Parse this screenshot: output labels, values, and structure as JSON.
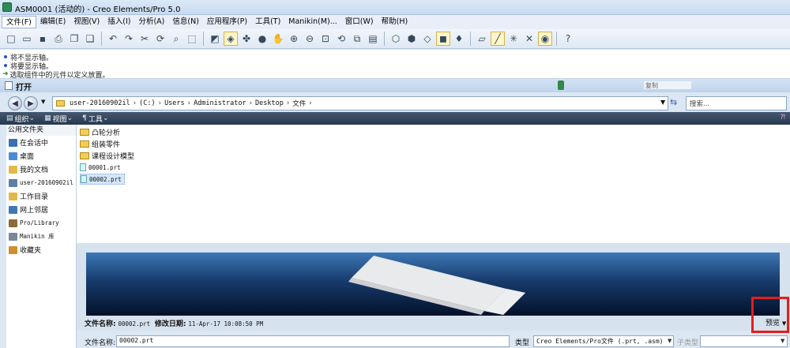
{
  "window": {
    "title": "ASM0001 (活动的) - Creo Elements/Pro 5.0"
  },
  "menu": [
    "文件(F)",
    "编辑(E)",
    "视图(V)",
    "插入(I)",
    "分析(A)",
    "信息(N)",
    "应用程序(P)",
    "工具(T)",
    "Manikin(M)...",
    "窗口(W)",
    "帮助(H)"
  ],
  "toolbar_icons": [
    "new-icon",
    "open-icon",
    "save-icon",
    "print-icon",
    "copy-icon",
    "paste-icon",
    "undo-icon",
    "redo-icon",
    "cut-icon",
    "regenerate-icon",
    "find-icon",
    "select-icon",
    "view-icon",
    "layer-icon",
    "appearance-icon",
    "spin-icon",
    "zoom-in-icon",
    "zoom-out-icon",
    "refit-icon",
    "orient-icon",
    "saved-views-icon",
    "wireframe-icon",
    "hidden-line-icon",
    "no-hidden-icon",
    "shading-icon",
    "model-tree-icon",
    "datum-plane-icon",
    "datum-axis-icon",
    "datum-point-icon",
    "csys-icon",
    "whats-this-icon"
  ],
  "messages": [
    {
      "icon": "bullet",
      "text": "将不显示轴。"
    },
    {
      "icon": "bullet",
      "text": "将要显示轴。"
    },
    {
      "icon": "arrow",
      "text": "选取组件中的元件以定义放置。"
    }
  ],
  "dialog": {
    "title": "打开",
    "faded_label": "复制",
    "address": {
      "crumbs": [
        "user-20160902il",
        "(C:)",
        "Users",
        "Administrator",
        "Desktop",
        "文件"
      ]
    },
    "search_placeholder": "搜索...",
    "organize": {
      "org_label": "组织",
      "view_label": "视图",
      "tools_label": "工具"
    },
    "left_panel": {
      "header": "公用文件夹",
      "items": [
        {
          "label": "在会话中",
          "color": "#3a6fb5"
        },
        {
          "label": "桌面",
          "color": "#4a8bd6"
        },
        {
          "label": "我的文档",
          "color": "#e2b847"
        },
        {
          "label": "user-20160902il",
          "color": "#5a7fa8"
        },
        {
          "label": "工作目录",
          "color": "#e2b847"
        },
        {
          "label": "网上邻居",
          "color": "#3f78b4"
        },
        {
          "label": "Pro/Library",
          "color": "#8a6a3a"
        },
        {
          "label": "Manikin 库",
          "color": "#7a8898"
        },
        {
          "label": "收藏夹",
          "color": "#cf8f2f"
        }
      ]
    },
    "files": [
      {
        "name": "凸轮分析",
        "kind": "folder"
      },
      {
        "name": "组装零件",
        "kind": "folder"
      },
      {
        "name": "课程设计模型",
        "kind": "folder"
      },
      {
        "name": "00001.prt",
        "kind": "part"
      },
      {
        "name": "00002.prt",
        "kind": "part",
        "selected": true
      }
    ],
    "info": {
      "name_label": "文件名称",
      "name_value": "00002.prt",
      "date_label": "修改日期",
      "date_value": "11-Apr-17 10:08:50 PM"
    },
    "preview_label": "预览",
    "bottom": {
      "filename_label": "文件名称:",
      "filename_value": "00002.prt",
      "type_label": "类型",
      "type_value": "Creo Elements/Pro文件 (.prt, .asm)",
      "subtype_label": "子类型",
      "subtype_value": ""
    }
  }
}
